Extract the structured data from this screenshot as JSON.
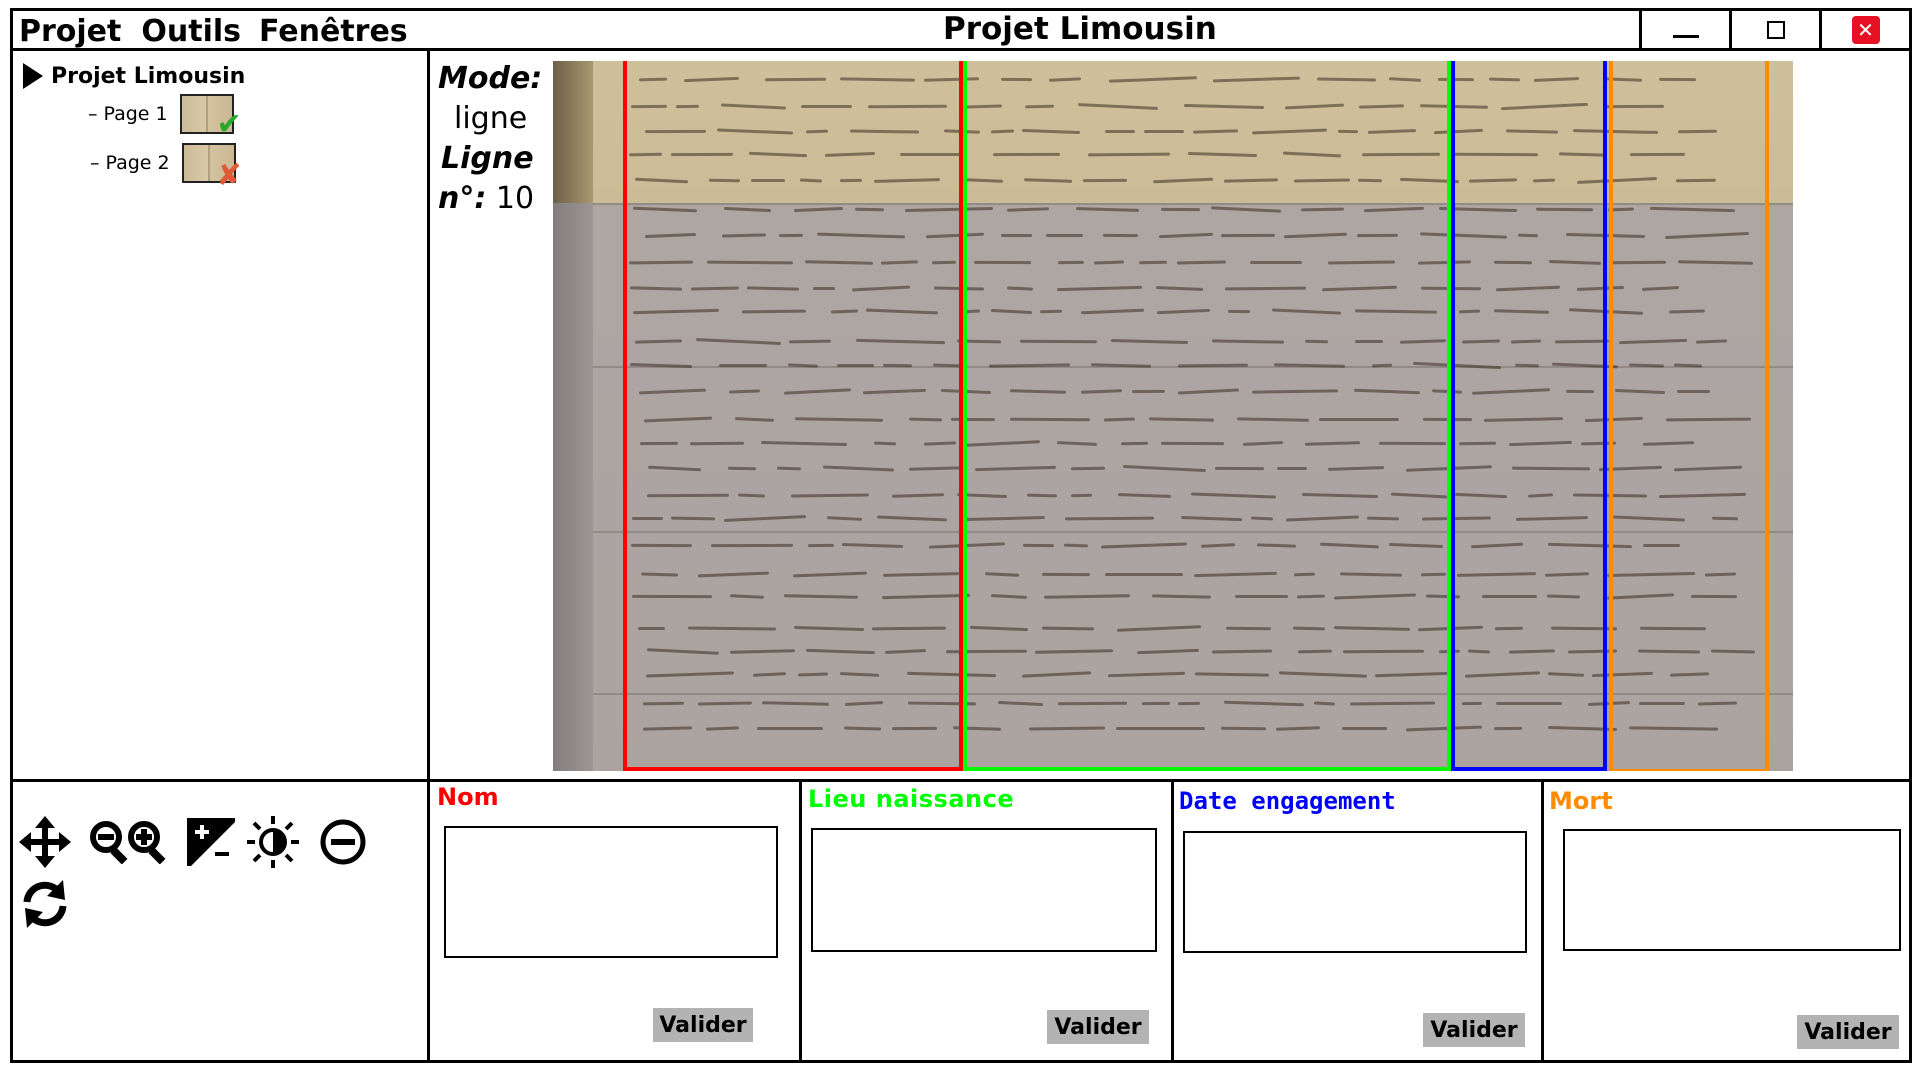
{
  "menu": {
    "items": [
      "Projet",
      "Outils",
      "Fenêtres"
    ]
  },
  "window": {
    "title": "Projet Limousin",
    "close_symbol": "✕"
  },
  "tree": {
    "root": "Projet Limousin",
    "pages": [
      {
        "label": "Page 1",
        "status": "validated",
        "status_icon": "check-icon"
      },
      {
        "label": "Page 2",
        "status": "rejected",
        "status_icon": "x-icon"
      }
    ]
  },
  "mode": {
    "mode_label": "Mode:",
    "mode_value": "ligne",
    "line_label": "Ligne",
    "line_no_label": "n°:",
    "line_no_value": "10"
  },
  "document": {
    "columns": [
      {
        "name": "Nom",
        "color": "#ff0000"
      },
      {
        "name": "Lieu naissance",
        "color": "#00ff00"
      },
      {
        "name": "Date engagement",
        "color": "#0000ff"
      },
      {
        "name": "Mort",
        "color": "#ff8c00"
      }
    ]
  },
  "tools": [
    "move-icon",
    "zoom-out-icon",
    "zoom-in-icon",
    "contrast-icon",
    "brightness-icon",
    "minus-icon",
    "refresh-icon"
  ],
  "fields": [
    {
      "label": "Nom",
      "color": "#ff0000",
      "button": "Valider"
    },
    {
      "label": "Lieu naissance",
      "color": "#00ff00",
      "button": "Valider"
    },
    {
      "label": "Date engagement",
      "color": "#0000ff",
      "button": "Valider"
    },
    {
      "label": "Mort",
      "color": "#ff8c00",
      "button": "Valider"
    }
  ]
}
